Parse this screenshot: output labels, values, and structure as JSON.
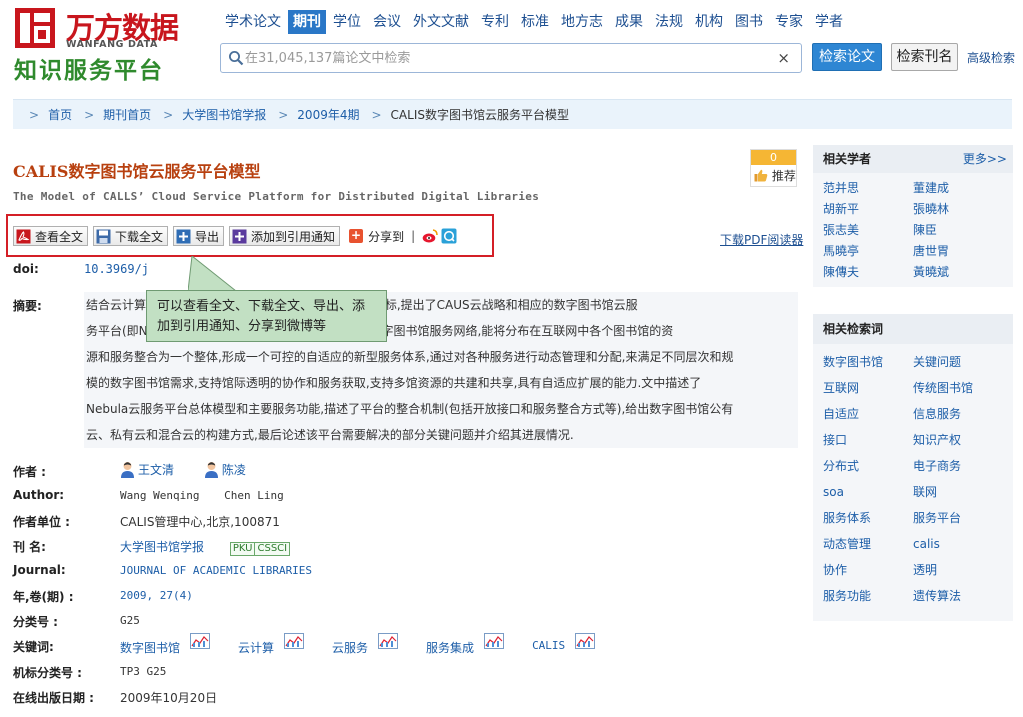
{
  "logo": {
    "cn": "万方数据",
    "en": "WANFANG DATA",
    "slogan": "知识服务平台"
  },
  "nav": [
    {
      "label": "学术论文",
      "active": false
    },
    {
      "label": "期刊",
      "active": true
    },
    {
      "label": "学位",
      "active": false
    },
    {
      "label": "会议",
      "active": false
    },
    {
      "label": "外文文献",
      "active": false
    },
    {
      "label": "专利",
      "active": false
    },
    {
      "label": "标准",
      "active": false
    },
    {
      "label": "地方志",
      "active": false
    },
    {
      "label": "成果",
      "active": false
    },
    {
      "label": "法规",
      "active": false
    },
    {
      "label": "机构",
      "active": false
    },
    {
      "label": "图书",
      "active": false
    },
    {
      "label": "专家",
      "active": false
    },
    {
      "label": "学者",
      "active": false
    }
  ],
  "search": {
    "placeholder": "在31,045,137篇论文中检索",
    "value": "",
    "clear": "×",
    "btn_paper": "检索论文",
    "btn_journal": "检索刊名",
    "advanced": "高级检索"
  },
  "breadcrumb": [
    "首页",
    "期刊首页",
    "大学图书馆学报",
    "2009年4期",
    "CALIS数字图书馆云服务平台模型"
  ],
  "breadcrumb_sep": ">",
  "article": {
    "title": "CALIS数字图书馆云服务平台模型",
    "title_en": "The Model of CALLS’ Cloud Service Platform for Distributed Digital Libraries",
    "recommend_count": "0",
    "recommend_label": "推荐"
  },
  "toolbar": {
    "view_full": "查看全文",
    "download_full": "下载全文",
    "export": "导出",
    "add_citation": "添加到引用通知",
    "share": "分享到",
    "pipe": "|",
    "pdf_reader": "下载PDF阅读器"
  },
  "doi": {
    "label": "doi:",
    "value": "10.3969/j"
  },
  "abstract": {
    "label": "摘要:",
    "lines": [
      "结合云计算技术的发展和CALIS“十五”成果和三期建设目标,提出了CAUS云战略和相应的数字图书馆云服",
      "务平台(即Nebula平台),目的是构建一个分布式的公共数字图书馆服务网络,能将分布在互联网中各个图书馆的资",
      "源和服务整合为一个整体,形成一个可控的自适应的新型服务体系,通过对各种服务进行动态管理和分配,来满足不同层次和规",
      "模的数字图书馆需求,支持馆际透明的协作和服务获取,支持多馆资源的共建和共享,具有自适应扩展的能力.文中描述了",
      "Nebula云服务平台总体模型和主要服务功能,描述了平台的整合机制(包括开放接口和服务整合方式等),给出数字图书馆公有",
      "云、私有云和混合云的构建方式,最后论述该平台需要解决的部分关键问题并介绍其进展情况."
    ]
  },
  "callout": "可以查看全文、下载全文、导出、添加到引用通知、分享到微博等",
  "meta": {
    "authors_label": "作者 :",
    "authors": [
      "王文清",
      "陈凌"
    ],
    "author_en_label": "Author:",
    "author_en": [
      "Wang Wenqing",
      "Chen Ling"
    ],
    "unit_label": "作者单位 :",
    "unit": "CALIS管理中心,北京,100871",
    "journal_label": "刊 名:",
    "journal": "大学图书馆学报",
    "badges": [
      "PKU",
      "CSSCI"
    ],
    "journal_en_label": "Journal:",
    "journal_en": "JOURNAL OF ACADEMIC LIBRARIES",
    "year_label": "年,卷(期) :",
    "year": "2009, 27(4)",
    "class_label": "分类号 :",
    "class": "G25",
    "keywords_label": "关键词:",
    "keywords": [
      "数字图书馆",
      "云计算",
      "云服务",
      "服务集成",
      "CALIS"
    ],
    "inst_class_label": "机标分类号 :",
    "inst_class": "TP3 G25",
    "online_label": "在线出版日期 :",
    "online": "2009年10月20日"
  },
  "sidebar": {
    "scholars_title": "相关学者",
    "more": "更多>>",
    "scholars": [
      "范并思",
      "董建成",
      "胡新平",
      "張曉林",
      "張志美",
      "陳臣",
      "馬曉亭",
      "唐世胃",
      "陳傳夫",
      "黃曉斌"
    ],
    "terms_title": "相关检索词",
    "terms": [
      "数字图书馆",
      "关键问题",
      "互联网",
      "传统图书馆",
      "自适应",
      "信息服务",
      "接口",
      "知识产权",
      "分布式",
      "电子商务",
      "soa",
      "联网",
      "服务体系",
      "服务平台",
      "动态管理",
      "calis",
      "协作",
      "透明",
      "服务功能",
      "遗传算法"
    ]
  },
  "colors": {
    "brand_red": "#c8161d",
    "brand_green": "#2f8a2d",
    "nav_active": "#2a77c7",
    "link": "#1d5ea8",
    "title": "#b8400f",
    "highlight_frame": "#d41f26",
    "callout_bg": "#c2e0c3"
  },
  "icons": [
    "logo-mark-icon",
    "search-icon",
    "pdf-icon",
    "save-icon",
    "export-plus-icon",
    "add-plus-icon",
    "share-plus-icon",
    "weibo-icon",
    "qzone-icon",
    "person-icon",
    "chart-icon",
    "thumb-icon"
  ]
}
